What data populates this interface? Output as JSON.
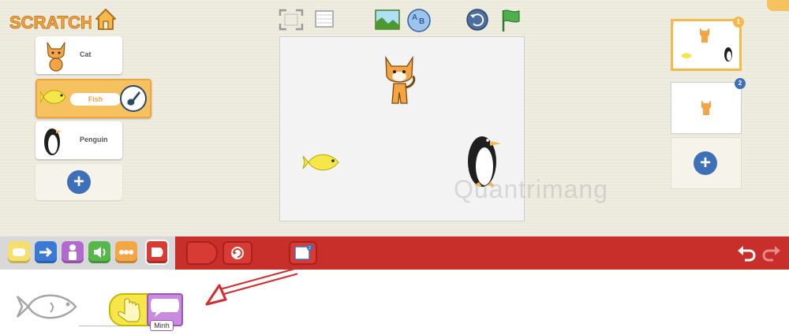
{
  "app": {
    "name": "ScratchJr",
    "logo_text": "SCRATCHJr"
  },
  "sprites": [
    {
      "name": "Cat",
      "selected": false
    },
    {
      "name": "Fish",
      "selected": true
    },
    {
      "name": "Penguin",
      "selected": false
    }
  ],
  "pages": [
    {
      "number": "1",
      "active": true
    },
    {
      "number": "2",
      "active": false
    }
  ],
  "palette": {
    "categories": [
      "triggering",
      "motion",
      "looks",
      "sound",
      "control",
      "end"
    ],
    "selected_category": "end",
    "colors": {
      "active_bar": "#c92f2a",
      "triggering": "#f5e06b",
      "motion": "#3a7ad6",
      "looks": "#b36ad0",
      "sound": "#56b84a",
      "control": "#f6a544",
      "end": "#d93a33"
    }
  },
  "script": {
    "say_block_text": "Minh"
  },
  "watermark": "Quantrimang"
}
